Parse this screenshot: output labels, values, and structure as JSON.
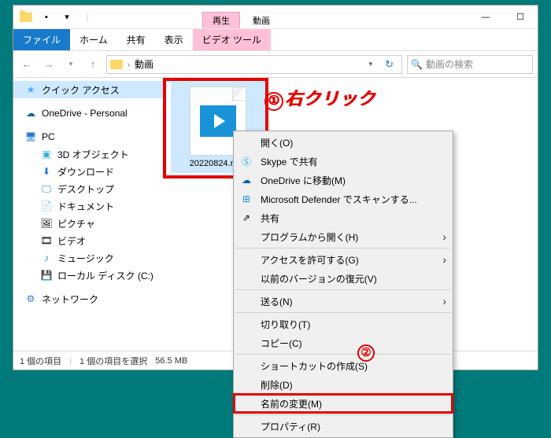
{
  "titlebar": {
    "playback_tab": "再生",
    "section_label": "動画"
  },
  "win": {
    "min": "—",
    "max": "☐"
  },
  "ribbon": {
    "file": "ファイル",
    "home": "ホーム",
    "share": "共有",
    "view": "表示",
    "video_tools": "ビデオ ツール"
  },
  "nav": {
    "back": "←",
    "fwd": "→",
    "up": "↑"
  },
  "address": {
    "location": "動画"
  },
  "search": {
    "placeholder": "動画の検索"
  },
  "sidebar": {
    "quick": "クイック アクセス",
    "onedrive": "OneDrive - Personal",
    "pc": "PC",
    "obj3d": "3D オブジェクト",
    "downloads": "ダウンロード",
    "desktop": "デスクトップ",
    "documents": "ドキュメント",
    "pictures": "ピクチャ",
    "videos": "ビデオ",
    "music": "ミュージック",
    "localdisk": "ローカル ディスク (C:)",
    "network": "ネットワーク"
  },
  "file": {
    "name": "20220824.mov"
  },
  "status": {
    "count": "1 個の項目",
    "selected": "1 個の項目を選択",
    "size": "56.5 MB"
  },
  "ctx": {
    "open": "開く(O)",
    "skype": "Skype で共有",
    "onedrive_move": "OneDrive に移動(M)",
    "defender": "Microsoft Defender でスキャンする...",
    "share": "共有",
    "openwith": "プログラムから開く(H)",
    "access": "アクセスを許可する(G)",
    "restore": "以前のバージョンの復元(V)",
    "sendto": "送る(N)",
    "cut": "切り取り(T)",
    "copy": "コピー(C)",
    "shortcut": "ショートカットの作成(S)",
    "delete": "削除(D)",
    "rename": "名前の変更(M)",
    "properties": "プロパティ(R)"
  },
  "annotations": {
    "a1_num": "①",
    "a1_text": "右クリック",
    "a2_num": "②"
  }
}
